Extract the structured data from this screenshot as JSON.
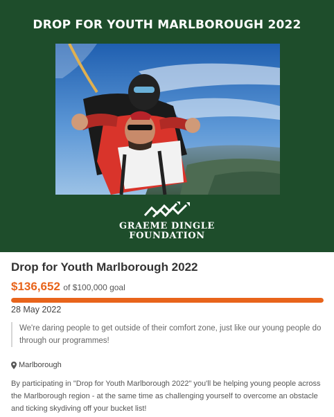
{
  "banner": {
    "title": "DROP FOR YOUTH MARLBOROUGH 2022",
    "background_color": "#1e4d2b",
    "image_description_icon": "skydiving-photo",
    "logo": {
      "line1": "GRAEME DINGLE",
      "line2": "FOUNDATION"
    }
  },
  "campaign": {
    "title": "Drop for Youth Marlborough 2022",
    "amount_raised": "$136,652",
    "goal_text": "of $100,000 goal",
    "progress_fraction": 1.0,
    "date": "28 May 2022",
    "quote": "We're daring people to get outside of their comfort zone, just like our young people do through our programmes!",
    "location_icon": "map-pin-icon",
    "location": "Marlborough",
    "description": "By participating in \"Drop for Youth Marlborough 2022\" you'll be helping young people across the Marlborough region - at the same time as challenging yourself to overcome an obstacle and ticking skydiving off your bucket list!",
    "accent_color": "#e8641b"
  }
}
